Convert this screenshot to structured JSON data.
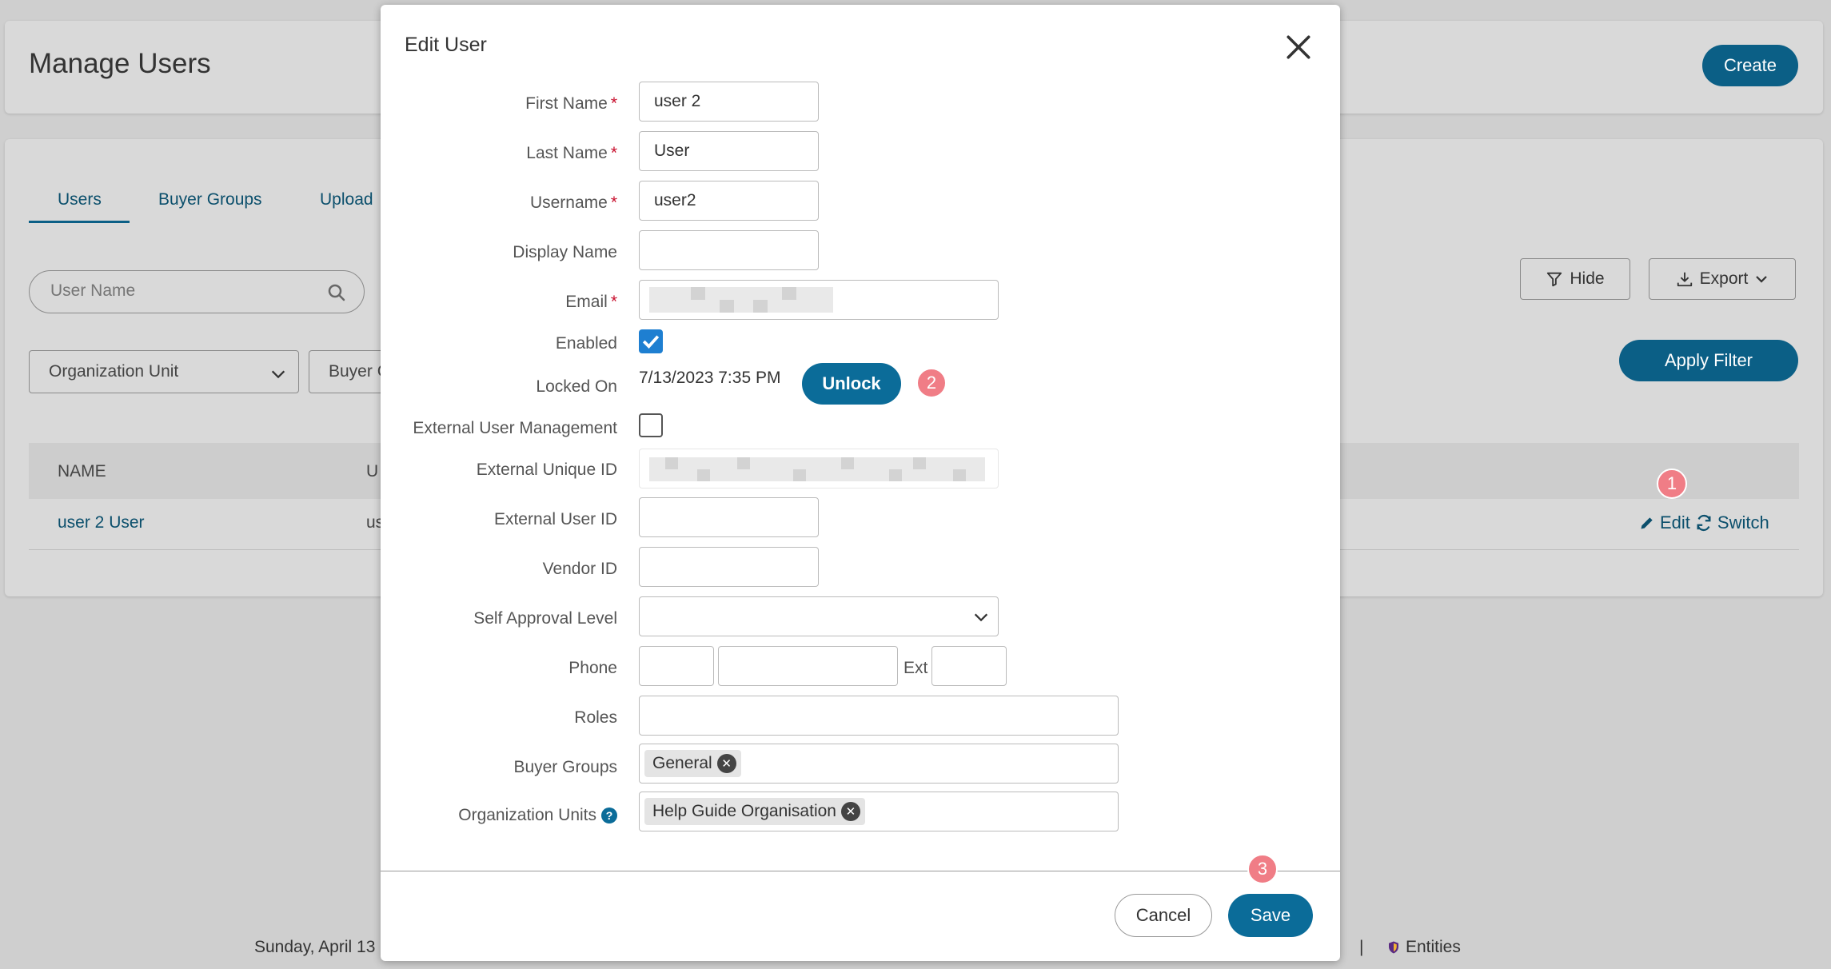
{
  "page": {
    "title": "Manage Users",
    "create_label": "Create",
    "tabs": [
      {
        "label": "Users"
      },
      {
        "label": "Buyer Groups"
      },
      {
        "label": "Upload"
      }
    ],
    "search": {
      "placeholder": "User Name"
    },
    "hide_label": "Hide",
    "export_label": "Export",
    "apply_filter_label": "Apply Filter",
    "org_unit_filter": "Organization Unit",
    "buyer_filter": "Buyer G",
    "table": {
      "headers": [
        "NAME",
        "U"
      ],
      "rows": [
        {
          "name": "user 2 User",
          "username": "us",
          "edit_label": "Edit",
          "switch_label": "Switch"
        }
      ]
    },
    "footer_date": "Sunday, April 13",
    "footer_separator": "|",
    "footer_entities": "Entities"
  },
  "modal": {
    "title": "Edit User",
    "fields": {
      "first_name": {
        "label": "First Name",
        "required": "*",
        "value": "user 2"
      },
      "last_name": {
        "label": "Last Name",
        "required": "*",
        "value": "User"
      },
      "username": {
        "label": "Username",
        "required": "*",
        "value": "user2"
      },
      "display_name": {
        "label": "Display Name",
        "value": ""
      },
      "email": {
        "label": "Email",
        "required": "*",
        "value": ""
      },
      "enabled": {
        "label": "Enabled",
        "checked": true
      },
      "locked_on": {
        "label": "Locked On",
        "value": "7/13/2023 7:35 PM"
      },
      "external_user_management": {
        "label": "External User Management",
        "checked": false
      },
      "external_unique_id": {
        "label": "External Unique ID",
        "value": ""
      },
      "external_user_id": {
        "label": "External User ID",
        "value": ""
      },
      "vendor_id": {
        "label": "Vendor ID",
        "value": ""
      },
      "self_approval_level": {
        "label": "Self Approval Level",
        "value": ""
      },
      "phone": {
        "label": "Phone",
        "ext_label": "Ext"
      },
      "roles": {
        "label": "Roles",
        "value": ""
      },
      "buyer_groups": {
        "label": "Buyer Groups",
        "chips": [
          "General"
        ]
      },
      "organization_units": {
        "label": "Organization Units",
        "chips": [
          "Help Guide Organisation"
        ]
      }
    },
    "unlock_label": "Unlock",
    "cancel_label": "Cancel",
    "save_label": "Save"
  },
  "callouts": [
    "1",
    "2",
    "3"
  ],
  "colors": {
    "primary": "#0b6c99",
    "required": "#c8102e",
    "callout": "#f07d86",
    "checkbox": "#1e7fd1"
  }
}
